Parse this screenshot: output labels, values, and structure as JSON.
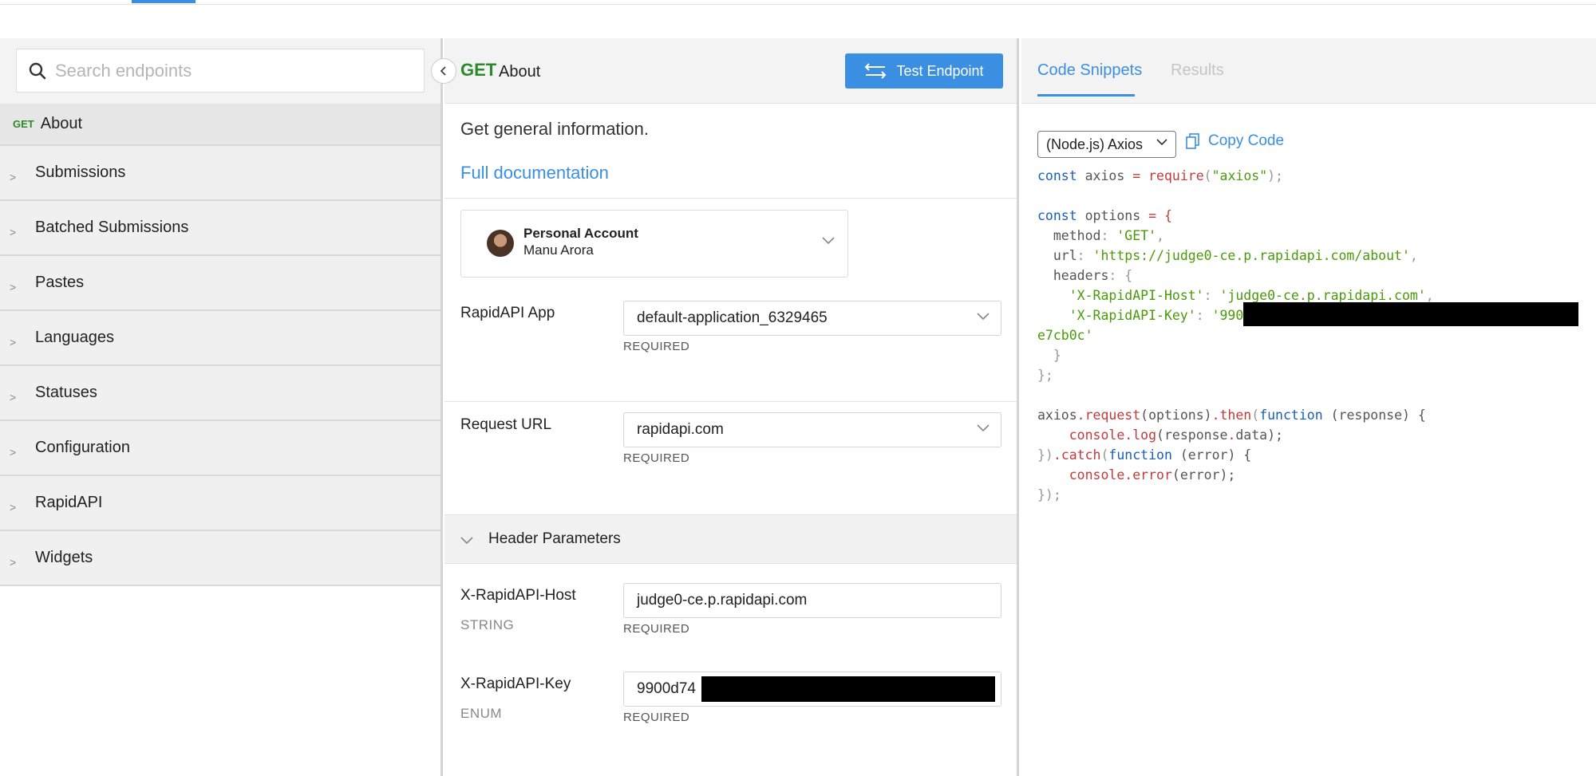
{
  "sidebar": {
    "search_placeholder": "Search endpoints",
    "active_item": {
      "method": "GET",
      "label": "About"
    },
    "groups": [
      {
        "label": "Submissions"
      },
      {
        "label": "Batched Submissions"
      },
      {
        "label": "Pastes"
      },
      {
        "label": "Languages"
      },
      {
        "label": "Statuses"
      },
      {
        "label": "Configuration"
      },
      {
        "label": "RapidAPI"
      },
      {
        "label": "Widgets"
      }
    ]
  },
  "endpoint": {
    "method": "GET",
    "title": "About",
    "test_button": "Test Endpoint",
    "description": "Get general information.",
    "full_doc_link": "Full documentation"
  },
  "account": {
    "name": "Personal Account",
    "user": "Manu Arora"
  },
  "fields": {
    "app": {
      "label": "RapidAPI App",
      "value": "default-application_6329465",
      "required": "REQUIRED"
    },
    "url": {
      "label": "Request URL",
      "value": "rapidapi.com",
      "required": "REQUIRED"
    },
    "header_section": "Header Parameters",
    "host": {
      "label": "X-RapidAPI-Host",
      "type": "STRING",
      "value": "judge0-ce.p.rapidapi.com",
      "required": "REQUIRED"
    },
    "key": {
      "label": "X-RapidAPI-Key",
      "type": "ENUM",
      "value": "9900d74",
      "required": "REQUIRED"
    }
  },
  "right": {
    "tab_snippets": "Code Snippets",
    "tab_results": "Results",
    "language": "(Node.js) Axios",
    "copy_label": "Copy Code",
    "code": {
      "l1_kw": "const",
      "l1_var": " axios ",
      "l1_op": "= ",
      "l1_fn": "require",
      "l1_p1": "(",
      "l1_str": "\"axios\"",
      "l1_p2": ");",
      "l3_kw": "const",
      "l3_rest": " options ",
      "l3_op": "= {",
      "l4_key": "  method",
      "l4_p": ": ",
      "l4_str": "'GET'",
      "l4_c": ",",
      "l5_key": "  url",
      "l5_p": ": ",
      "l5_str": "'https://judge0-ce.p.rapidapi.com/about'",
      "l5_c": ",",
      "l6_key": "  headers",
      "l6_p": ": {",
      "l7_str1": "    'X-RapidAPI-Host'",
      "l7_p": ": ",
      "l7_str2": "'judge0-ce.p.rapidapi.com'",
      "l7_c": ",",
      "l8_str1": "    'X-RapidAPI-Key'",
      "l8_p": ": ",
      "l8_str2": "'990",
      "l9_str": "e7cb0c'",
      "l10": "  }",
      "l11": "};",
      "l13_a": "axios",
      "l13_b": ".",
      "l13_c": "request",
      "l13_d": "(options)",
      "l13_e": ".",
      "l13_f": "then",
      "l13_g": "(",
      "l13_h": "function",
      "l13_i": " (response) {",
      "l14_a": "    console",
      "l14_b": ".",
      "l14_c": "log",
      "l14_d": "(response",
      "l14_e": ".",
      "l14_f": "data);",
      "l15_a": "})",
      "l15_b": ".",
      "l15_c": "catch",
      "l15_d": "(",
      "l15_e": "function",
      "l15_f": " (error) {",
      "l16_a": "    console",
      "l16_b": ".",
      "l16_c": "error",
      "l16_d": "(error);",
      "l17": "});"
    }
  },
  "colors": {
    "accent": "#3a8fe2",
    "method_get": "#2a8a2a",
    "code_keyword": "#1a5fb4",
    "code_string": "#4a9a0a",
    "code_function": "#c23b3b"
  }
}
